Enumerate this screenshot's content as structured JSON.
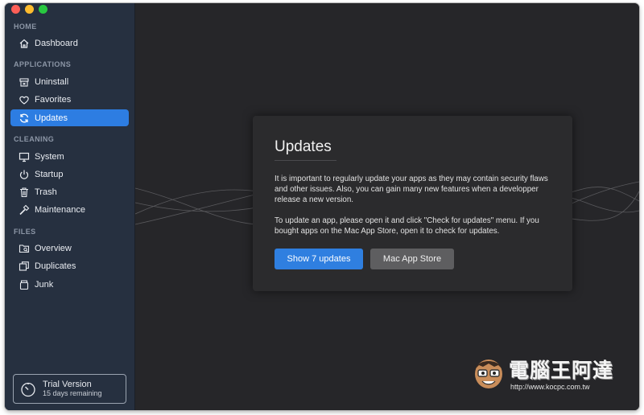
{
  "sidebar": {
    "sections": [
      {
        "label": "HOME",
        "items": [
          {
            "label": "Dashboard",
            "icon": "house-icon"
          }
        ]
      },
      {
        "label": "APPLICATIONS",
        "items": [
          {
            "label": "Uninstall",
            "icon": "uninstall-box-icon"
          },
          {
            "label": "Favorites",
            "icon": "heart-icon"
          },
          {
            "label": "Updates",
            "icon": "refresh-icon",
            "active": true
          }
        ]
      },
      {
        "label": "CLEANING",
        "items": [
          {
            "label": "System",
            "icon": "monitor-icon"
          },
          {
            "label": "Startup",
            "icon": "power-icon"
          },
          {
            "label": "Trash",
            "icon": "trash-icon"
          },
          {
            "label": "Maintenance",
            "icon": "hammer-icon"
          }
        ]
      },
      {
        "label": "FILES",
        "items": [
          {
            "label": "Overview",
            "icon": "folder-search-icon"
          },
          {
            "label": "Duplicates",
            "icon": "duplicates-icon"
          },
          {
            "label": "Junk",
            "icon": "junk-box-icon"
          }
        ]
      }
    ],
    "trial": {
      "title": "Trial Version",
      "subtitle": "15 days remaining"
    }
  },
  "card": {
    "title": "Updates",
    "paragraph1": "It is important to regularly update your apps as they may contain security flaws and other issues. Also, you can gain many new features when a developper release a new version.",
    "paragraph2": "To update an app, please open it and click \"Check for updates\" menu. If you bought apps on the Mac App Store, open it to check for updates.",
    "primary_button": "Show 7 updates",
    "secondary_button": "Mac App Store"
  },
  "watermark": {
    "text": "電腦王阿達",
    "url": "http://www.kocpc.com.tw"
  },
  "colors": {
    "accent": "#2d7de2",
    "sidebar_bg": "#263040",
    "main_bg": "#262629"
  }
}
